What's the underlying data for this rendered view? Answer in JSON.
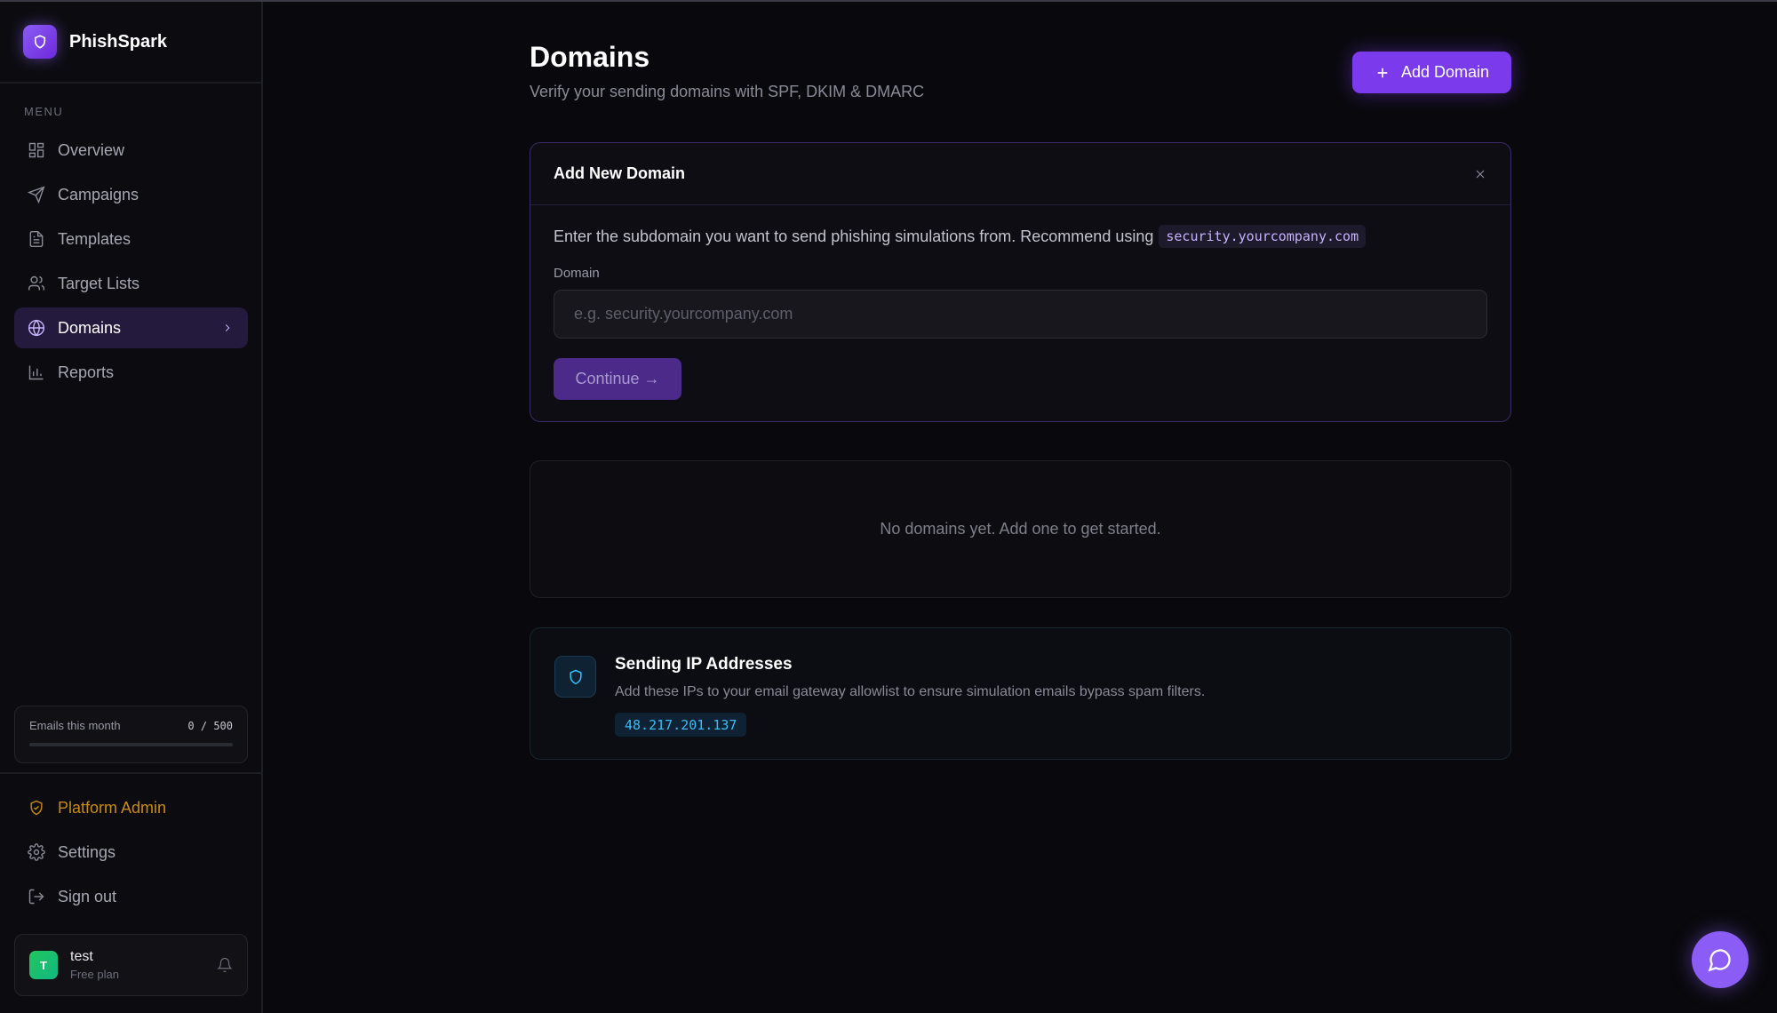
{
  "brand": {
    "name": "PhishSpark"
  },
  "menu_label": "MENU",
  "nav": [
    {
      "label": "Overview",
      "icon": "grid-icon"
    },
    {
      "label": "Campaigns",
      "icon": "send-icon"
    },
    {
      "label": "Templates",
      "icon": "file-icon"
    },
    {
      "label": "Target Lists",
      "icon": "users-icon"
    },
    {
      "label": "Domains",
      "icon": "globe-icon",
      "active": true
    },
    {
      "label": "Reports",
      "icon": "bar-chart-icon"
    }
  ],
  "usage": {
    "label": "Emails this month",
    "count": "0 / 500",
    "fraction": 0
  },
  "bottom_nav": [
    {
      "label": "Platform Admin",
      "icon": "shield-check-icon"
    },
    {
      "label": "Settings",
      "icon": "gear-icon"
    },
    {
      "label": "Sign out",
      "icon": "logout-icon"
    }
  ],
  "user": {
    "initial": "T",
    "name": "test",
    "plan": "Free plan"
  },
  "header": {
    "title": "Domains",
    "subtitle": "Verify your sending domains with SPF, DKIM & DMARC",
    "add_label": "Add Domain"
  },
  "add_card": {
    "title": "Add New Domain",
    "help": "Enter the subdomain you want to send phishing simulations from. Recommend using",
    "example": "security.yourcompany.com",
    "field_label": "Domain",
    "placeholder": "e.g. security.yourcompany.com",
    "value": "",
    "continue_label": "Continue →"
  },
  "empty": {
    "message": "No domains yet. Add one to get started."
  },
  "ip_card": {
    "title": "Sending IP Addresses",
    "description": "Add these IPs to your email gateway allowlist to ensure simulation emails bypass spam filters.",
    "ip": "48.217.201.137"
  },
  "colors": {
    "accent": "#7c3aed",
    "admin": "#c88a14",
    "ip": "#38bdf8"
  }
}
